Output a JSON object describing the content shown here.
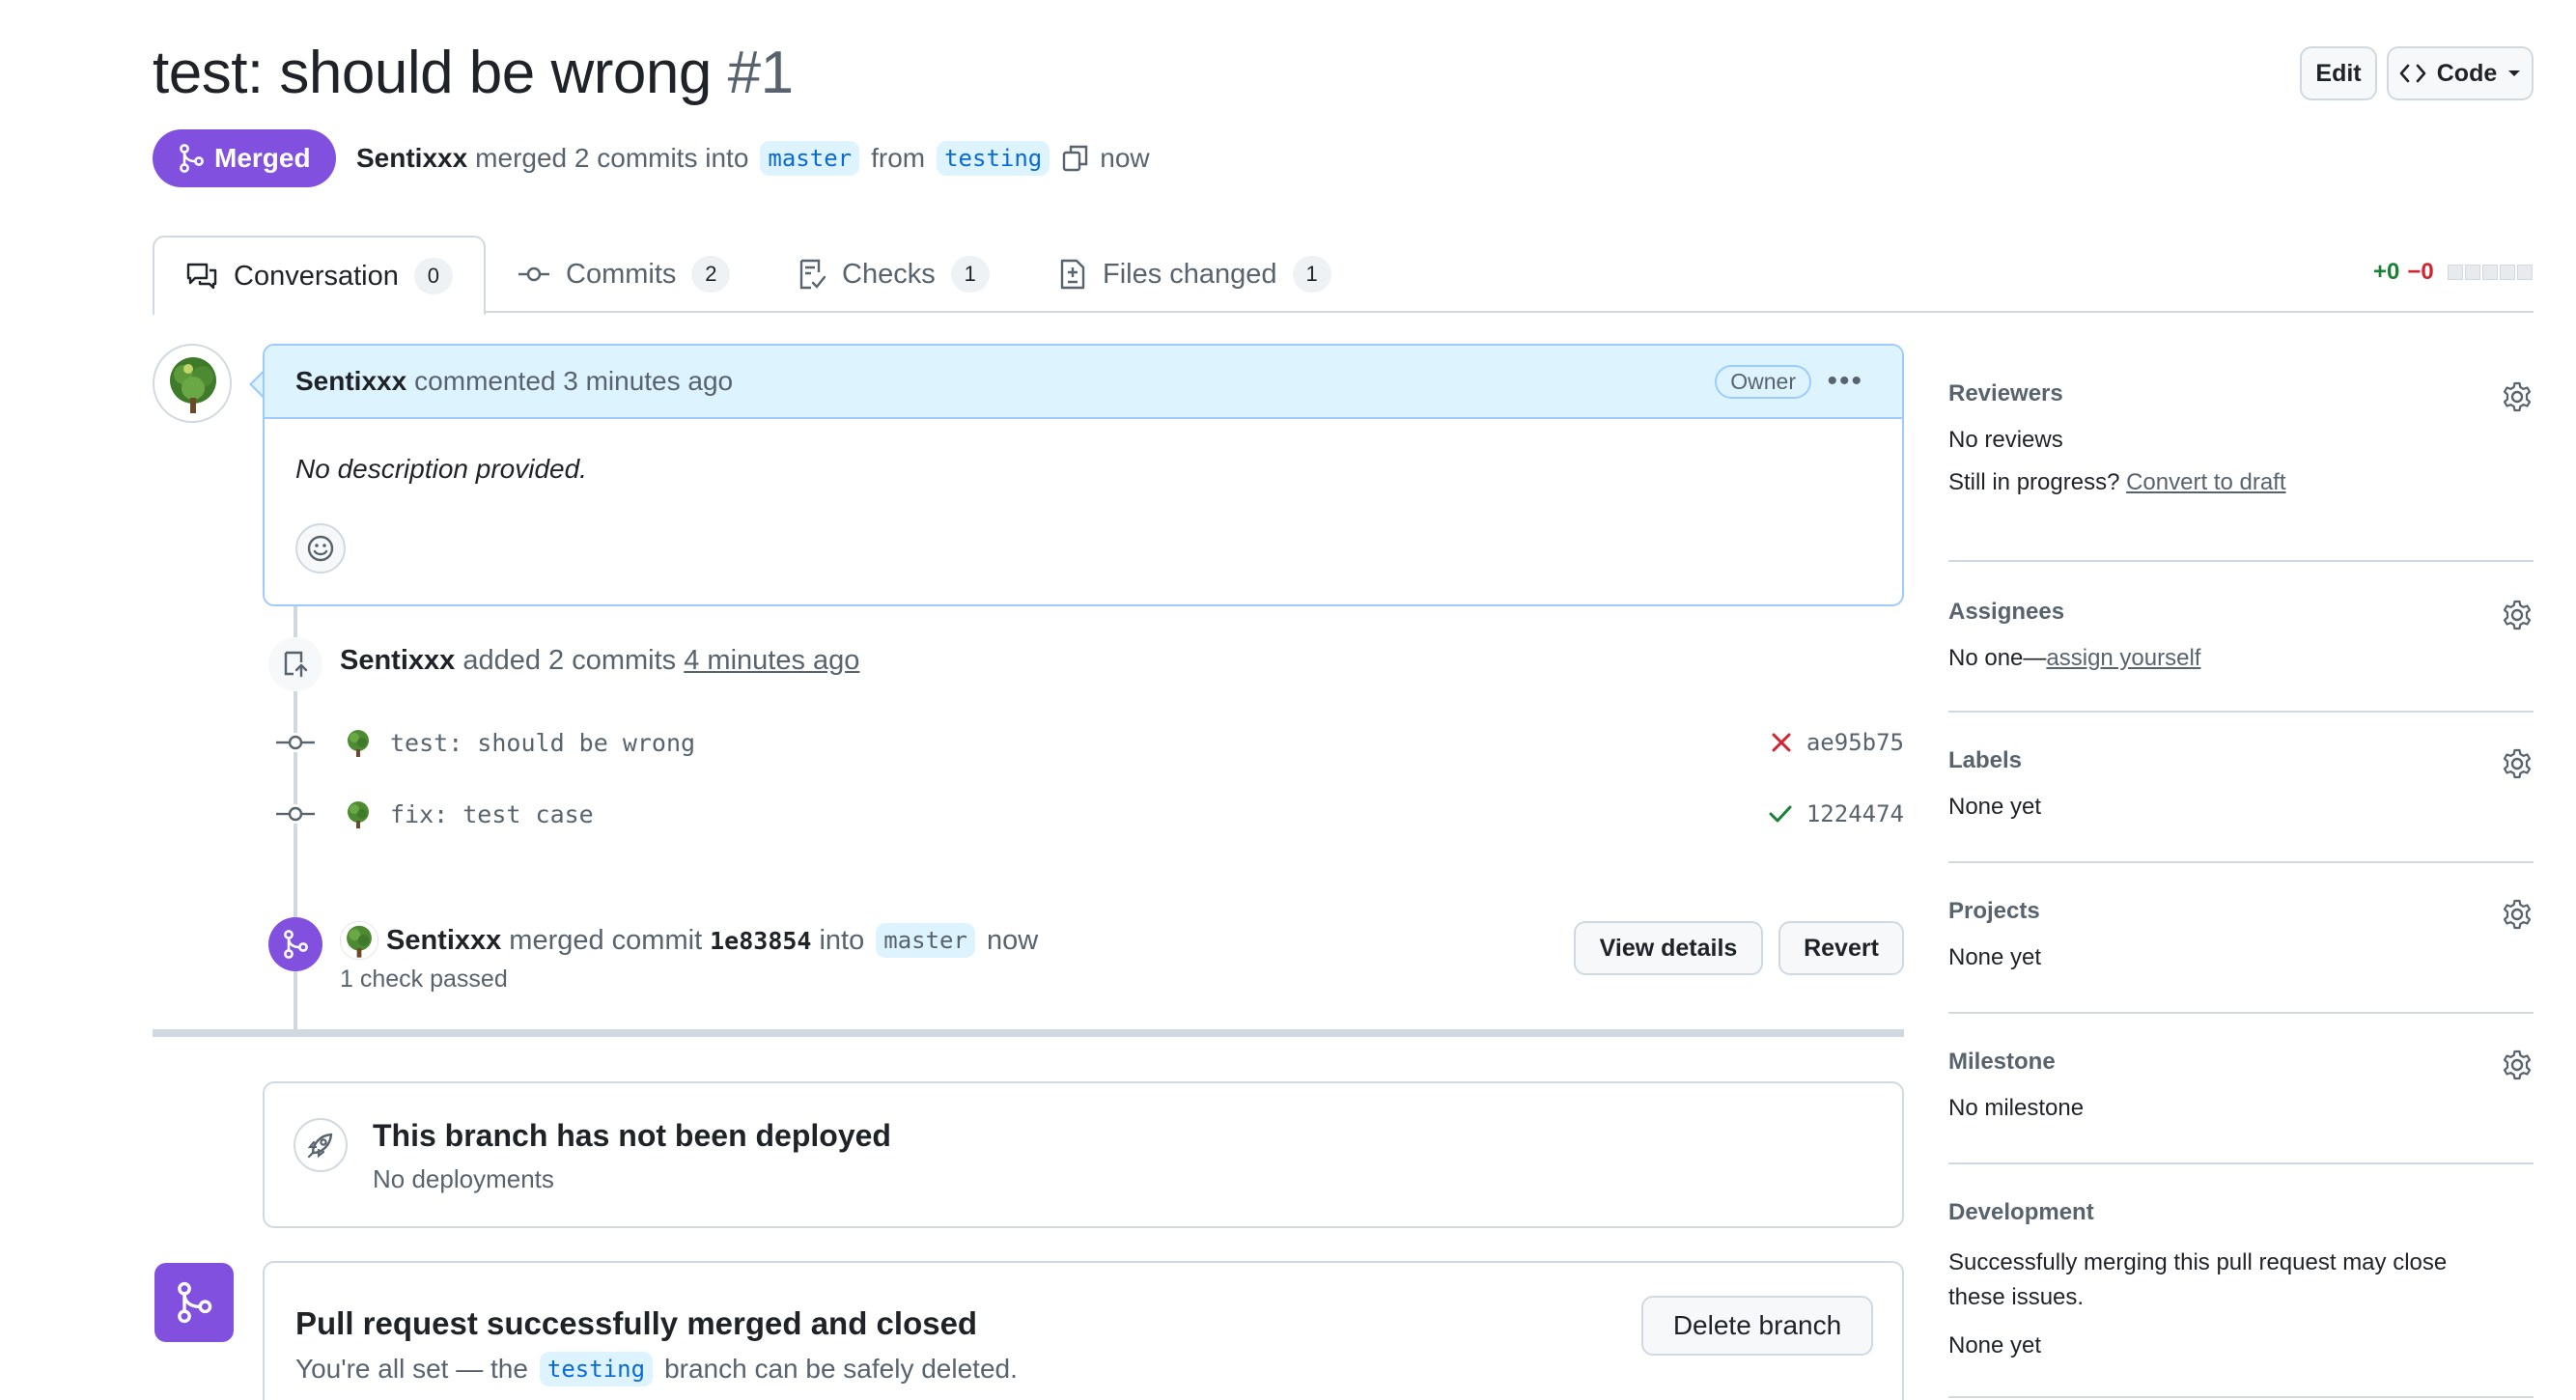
{
  "header": {
    "title": "test: should be wrong",
    "number": "#1",
    "edit_label": "Edit",
    "code_label": "Code"
  },
  "status": {
    "state": "Merged",
    "author": "Sentixxx",
    "action": "merged 2 commits into",
    "base_branch": "master",
    "from_word": "from",
    "head_branch": "testing",
    "time": "now"
  },
  "tabs": [
    {
      "label": "Conversation",
      "count": "0"
    },
    {
      "label": "Commits",
      "count": "2"
    },
    {
      "label": "Checks",
      "count": "1"
    },
    {
      "label": "Files changed",
      "count": "1"
    }
  ],
  "diffstat": {
    "additions": "+0",
    "deletions": "−0"
  },
  "comment": {
    "author": "Sentixxx",
    "action": "commented 3 minutes ago",
    "badge": "Owner",
    "body": "No description provided."
  },
  "commits_event": {
    "author": "Sentixxx",
    "action": "added 2 commits",
    "time": "4 minutes ago",
    "commits": [
      {
        "message": "test: should be wrong",
        "sha": "ae95b75",
        "status": "fail"
      },
      {
        "message": "fix: test case",
        "sha": "1224474",
        "status": "pass"
      }
    ]
  },
  "merge_event": {
    "author": "Sentixxx",
    "action": "merged commit",
    "sha": "1e83854",
    "into_word": "into",
    "branch": "master",
    "time": "now",
    "checks": "1 check passed",
    "view_details_label": "View details",
    "revert_label": "Revert"
  },
  "deploy": {
    "title": "This branch has not been deployed",
    "subtitle": "No deployments"
  },
  "merged_box": {
    "title": "Pull request successfully merged and closed",
    "text_before": "You're all set — the",
    "branch": "testing",
    "text_after": "branch can be safely deleted.",
    "delete_label": "Delete branch"
  },
  "sidebar": {
    "reviewers": {
      "title": "Reviewers",
      "value": "No reviews",
      "prompt": "Still in progress?",
      "link": "Convert to draft"
    },
    "assignees": {
      "title": "Assignees",
      "value": "No one—",
      "link": "assign yourself"
    },
    "labels": {
      "title": "Labels",
      "value": "None yet"
    },
    "projects": {
      "title": "Projects",
      "value": "None yet"
    },
    "milestone": {
      "title": "Milestone",
      "value": "No milestone"
    },
    "development": {
      "title": "Development",
      "text": "Successfully merging this pull request may close these issues.",
      "value": "None yet"
    }
  },
  "colors": {
    "merged": "#8250df",
    "link": "#0969da",
    "success": "#1a7f37",
    "danger": "#d1242f",
    "border": "#d1d9e0"
  },
  "icons": [
    "git-merge-icon",
    "copy-icon",
    "comment-discussion-icon",
    "git-commit-icon",
    "checklist-icon",
    "file-diff-icon",
    "smiley-icon",
    "repo-push-icon",
    "x-icon",
    "check-icon",
    "rocket-icon",
    "gear-icon",
    "triangle-down-icon",
    "code-icon",
    "kebab-horizontal-icon"
  ]
}
